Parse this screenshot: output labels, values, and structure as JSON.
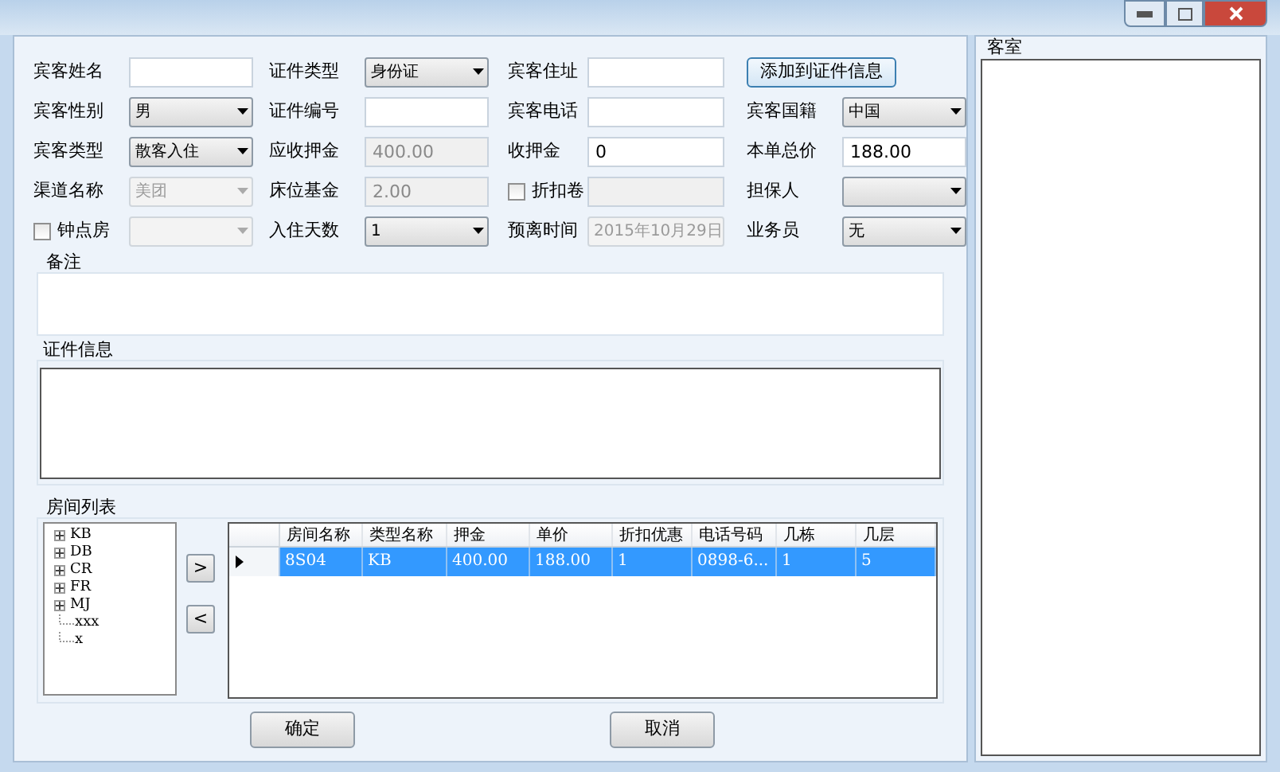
{
  "form_rows": [
    [
      {
        "label": "宾客姓名",
        "kind": "text",
        "disabled": false
      },
      {
        "label": "证件类型",
        "kind": "select",
        "value": "身份证",
        "disabled": false
      },
      {
        "label": "宾客住址",
        "kind": "text",
        "disabled": false
      },
      {
        "kind": "button",
        "value": "添加到证件信息"
      }
    ],
    [
      {
        "label": "宾客性别",
        "kind": "select",
        "value": "男",
        "disabled": false
      },
      {
        "label": "证件编号",
        "kind": "text",
        "disabled": false
      },
      {
        "label": "宾客电话",
        "kind": "text",
        "disabled": false
      },
      {
        "label": "宾客国籍",
        "kind": "select",
        "value": "中国",
        "disabled": false
      }
    ],
    [
      {
        "label": "宾客类型",
        "kind": "select",
        "value": "散客入住",
        "disabled": false
      },
      {
        "label": "应收押金",
        "kind": "text",
        "value": "400.00",
        "disabled": true
      },
      {
        "label": "收押金",
        "kind": "text",
        "value": "0",
        "disabled": false
      },
      {
        "label": "本单总价",
        "kind": "text",
        "value": "188.00",
        "disabled": false
      }
    ],
    [
      {
        "label": "渠道名称",
        "kind": "select",
        "value": "美团",
        "disabled": true
      },
      {
        "label": "床位基金",
        "kind": "text",
        "value": "2.00",
        "disabled": true
      },
      {
        "label": "折扣卷",
        "kind": "text",
        "checked": false,
        "disabled": true
      },
      {
        "label": "担保人",
        "kind": "select",
        "disabled": false
      }
    ],
    [
      {
        "label": "钟点房",
        "kind": "select",
        "checked": false,
        "disabled": true
      },
      {
        "label": "入住天数",
        "kind": "select",
        "value": "1",
        "disabled": false
      },
      {
        "label": "预离时间",
        "kind": "select",
        "value": "2015年10月29日",
        "disabled": true
      },
      {
        "label": "业务员",
        "kind": "select",
        "value": "无",
        "disabled": false
      }
    ]
  ],
  "remarks": {
    "title": "备注"
  },
  "id_info": {
    "title": "证件信息"
  },
  "room_list": {
    "title": "房间列表",
    "tree": [
      {
        "label": "KB",
        "kind": "group",
        "expanded": false
      },
      {
        "label": "DB",
        "kind": "group",
        "expanded": false
      },
      {
        "label": "CR",
        "kind": "group",
        "expanded": false
      },
      {
        "label": "FR",
        "kind": "group",
        "expanded": false
      },
      {
        "label": "MJ",
        "kind": "group",
        "expanded": false
      },
      {
        "label": "xxx",
        "kind": "leaf"
      },
      {
        "label": "x",
        "kind": "leaf"
      }
    ],
    "move_buttons": [
      ">",
      "<"
    ],
    "table": {
      "columns": [
        "房间名称",
        "类型名称",
        "押金",
        "单价",
        "折扣优惠",
        "电话号码",
        "几栋",
        "几层"
      ],
      "rows": [
        {
          "selected": true,
          "cells": [
            "8S04",
            "KB",
            "400.00",
            "188.00",
            "1",
            "0898-6...",
            "1",
            "5"
          ]
        }
      ]
    }
  },
  "buttons": [
    "确定",
    "取消"
  ],
  "rooms_panel": {
    "title": "客室"
  }
}
